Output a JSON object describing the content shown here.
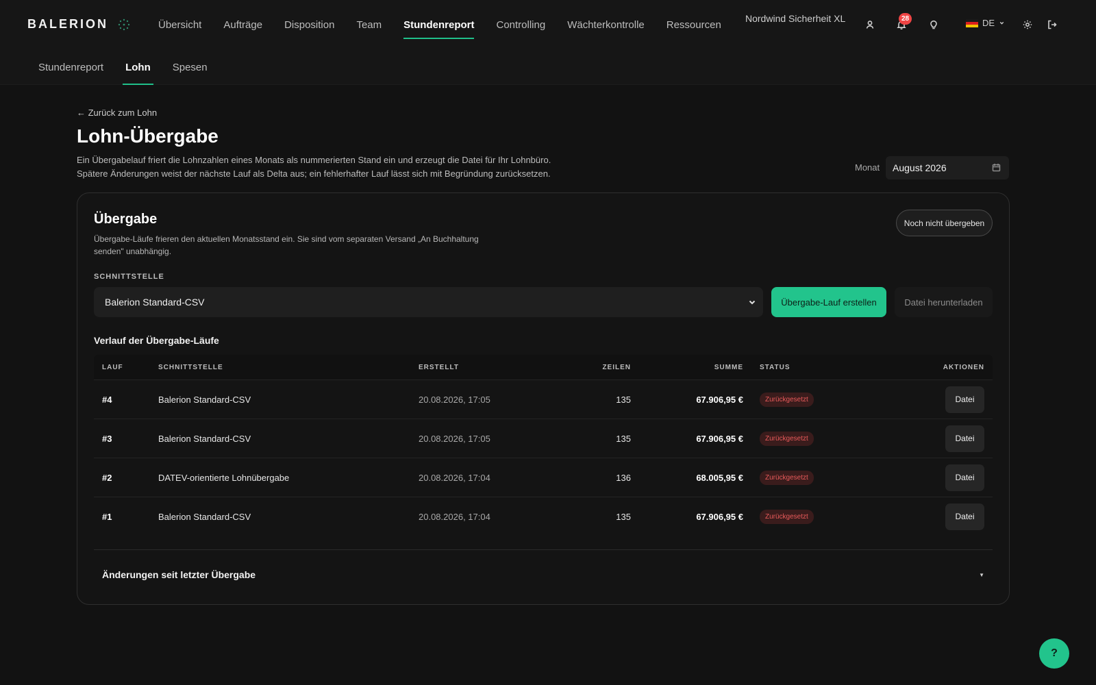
{
  "brand": {
    "name": "BALERION"
  },
  "nav": {
    "items": [
      {
        "label": "Übersicht"
      },
      {
        "label": "Aufträge"
      },
      {
        "label": "Disposition"
      },
      {
        "label": "Team"
      },
      {
        "label": "Stundenreport"
      },
      {
        "label": "Controlling"
      },
      {
        "label": "Wächterkontrolle"
      },
      {
        "label": "Ressourcen"
      }
    ],
    "active": "Stundenreport"
  },
  "header": {
    "company": "Nordwind Sicherheit XL",
    "notifications_count": "28",
    "language": "DE",
    "icons": [
      "user-icon",
      "bell-icon",
      "lightbulb-icon",
      "flag-de-icon",
      "chevron-down-icon",
      "gear-icon",
      "logout-icon"
    ]
  },
  "subnav": {
    "items": [
      {
        "label": "Stundenreport"
      },
      {
        "label": "Lohn"
      },
      {
        "label": "Spesen"
      }
    ],
    "active": "Lohn"
  },
  "page": {
    "back_link": "← Zurück zum Lohn",
    "title": "Lohn-Übergabe",
    "description": "Ein Übergabelauf friert die Lohnzahlen eines Monats als nummerierten Stand ein und erzeugt die Datei für Ihr Lohnbüro. Spätere Änderungen weist der nächste Lauf als Delta aus; ein fehlerhafter Lauf lässt sich mit Begründung zurücksetzen.",
    "month_label": "Monat",
    "month_value": "August 2026"
  },
  "card": {
    "title": "Übergabe",
    "description": "Übergabe-Läufe frieren den aktuellen Monatsstand ein. Sie sind vom separaten Versand „An Buchhaltung senden\" unabhängig.",
    "status_pill": "Noch nicht übergeben",
    "interface_label": "SCHNITTSTELLE",
    "interface_value": "Balerion Standard-CSV",
    "create_button": "Übergabe-Lauf erstellen",
    "download_button": "Datei herunterladen",
    "history_title": "Verlauf der Übergabe-Läufe",
    "changes_label": "Änderungen seit letzter Übergabe",
    "changes_caret": "▼"
  },
  "table": {
    "columns": {
      "lauf": "LAUF",
      "schnittstelle": "SCHNITTSTELLE",
      "erstellt": "ERSTELLT",
      "zeilen": "ZEILEN",
      "summe": "SUMME",
      "status": "STATUS",
      "aktionen": "AKTIONEN"
    },
    "rows": [
      {
        "lauf": "#4",
        "schnittstelle": "Balerion Standard-CSV",
        "erstellt": "20.08.2026, 17:05",
        "zeilen": "135",
        "summe": "67.906,95 €",
        "status": "Zurückgesetzt",
        "action": "Datei"
      },
      {
        "lauf": "#3",
        "schnittstelle": "Balerion Standard-CSV",
        "erstellt": "20.08.2026, 17:05",
        "zeilen": "135",
        "summe": "67.906,95 €",
        "status": "Zurückgesetzt",
        "action": "Datei"
      },
      {
        "lauf": "#2",
        "schnittstelle": "DATEV-orientierte Lohnübergabe",
        "erstellt": "20.08.2026, 17:04",
        "zeilen": "136",
        "summe": "68.005,95 €",
        "status": "Zurückgesetzt",
        "action": "Datei"
      },
      {
        "lauf": "#1",
        "schnittstelle": "Balerion Standard-CSV",
        "erstellt": "20.08.2026, 17:04",
        "zeilen": "135",
        "summe": "67.906,95 €",
        "status": "Zurückgesetzt",
        "action": "Datei"
      }
    ]
  },
  "help": {
    "label": "?"
  },
  "colors": {
    "accent": "#22c48c",
    "background": "#121212",
    "badge_red": "#ef4444",
    "status_reset_text": "#e85a5a",
    "status_reset_bg": "#3a1c1c"
  }
}
